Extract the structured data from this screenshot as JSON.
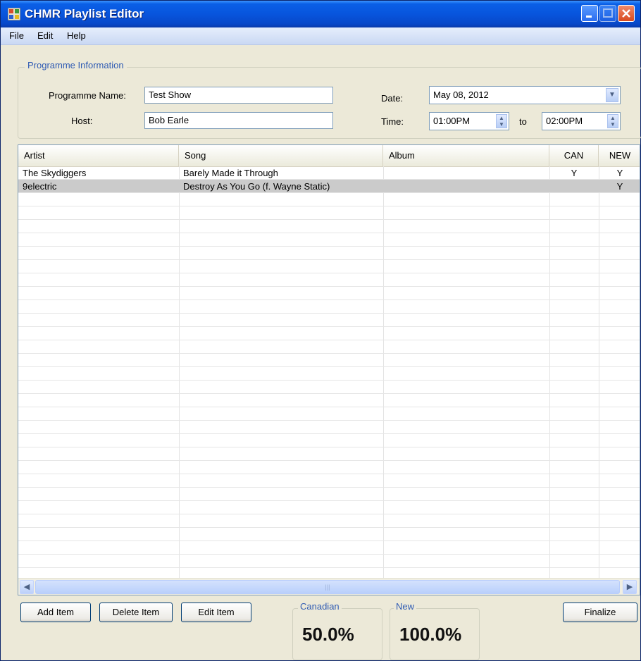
{
  "window": {
    "title": "CHMR Playlist Editor"
  },
  "menu": {
    "file": "File",
    "edit": "Edit",
    "help": "Help"
  },
  "programme_info": {
    "legend": "Programme Information",
    "name_label": "Programme Name:",
    "name_value": "Test Show",
    "host_label": "Host:",
    "host_value": "Bob Earle",
    "date_label": "Date:",
    "date_value": "May 08, 2012",
    "time_label": "Time:",
    "time_start": "01:00PM",
    "to_label": "to",
    "time_end": "02:00PM"
  },
  "playlist": {
    "columns": [
      "Artist",
      "Song",
      "Album",
      "CAN",
      "NEW"
    ],
    "rows": [
      {
        "artist": "The Skydiggers",
        "song": "Barely Made it Through",
        "album": "",
        "can": "Y",
        "new": "Y"
      },
      {
        "artist": "9electric",
        "song": "Destroy As You Go (f. Wayne Static)",
        "album": "",
        "can": "",
        "new": "Y"
      }
    ],
    "selected_row": 1
  },
  "actions": {
    "add": "Add Item",
    "delete": "Delete Item",
    "edit": "Edit Item",
    "finalize": "Finalize"
  },
  "stats": {
    "canadian_label": "Canadian",
    "canadian_value": "50.0%",
    "new_label": "New",
    "new_value": "100.0%"
  }
}
